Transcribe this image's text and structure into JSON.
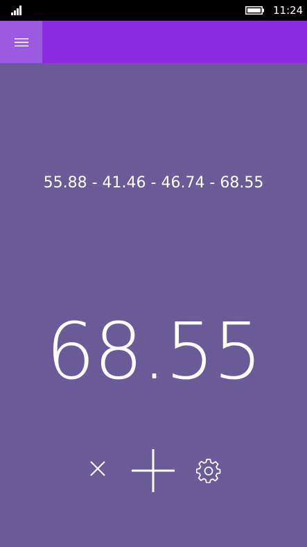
{
  "status_bar": {
    "time": "11:24",
    "signal_icon": "signal-bars-icon",
    "battery_icon": "battery-icon"
  },
  "header": {
    "menu_icon": "hamburger-menu-icon",
    "accent_color": "#8a2be2",
    "menu_button_color": "#9b5ae0"
  },
  "main": {
    "background_color": "#6b5a98",
    "history": "55.88 - 41.46 - 46.74 - 68.55",
    "current_value": "68.55"
  },
  "controls": {
    "clear_icon": "close-icon",
    "add_icon": "plus-icon",
    "settings_icon": "gear-icon"
  }
}
